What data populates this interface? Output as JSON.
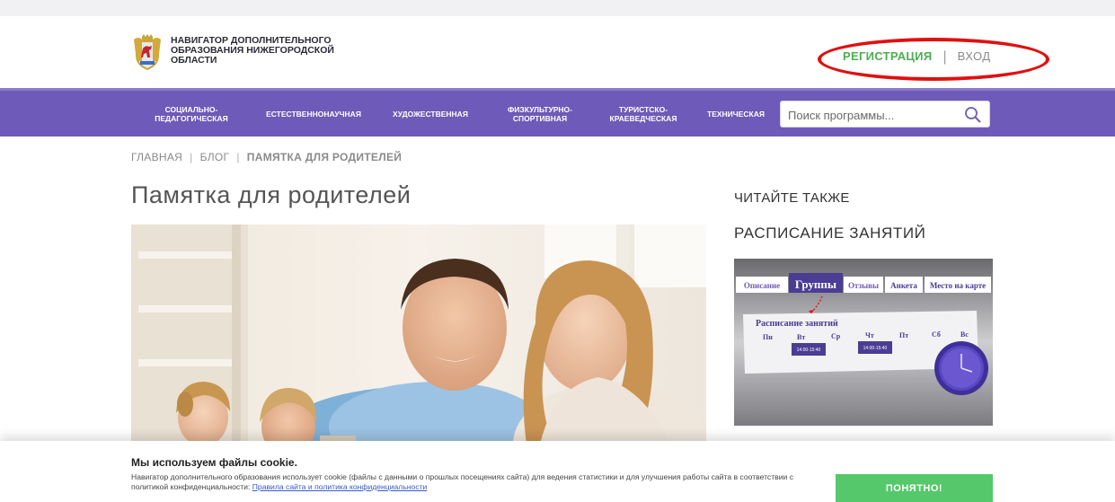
{
  "header": {
    "logo_line1": "НАВИГАТОР ДОПОЛНИТЕЛЬНОГО",
    "logo_line2": "ОБРАЗОВАНИЯ НИЖЕГОРОДСКОЙ",
    "logo_line3": "ОБЛАСТИ",
    "register_label": "РЕГИСТРАЦИЯ",
    "separator": "|",
    "login_label": "ВХОД"
  },
  "nav": {
    "items": [
      {
        "line1": "СОЦИАЛЬНО-",
        "line2": "ПЕДАГОГИЧЕСКАЯ"
      },
      {
        "line1": "ЕСТЕСТВЕННОНАУЧНАЯ",
        "line2": ""
      },
      {
        "line1": "ХУДОЖЕСТВЕННАЯ",
        "line2": ""
      },
      {
        "line1": "ФИЗКУЛЬТУРНО-",
        "line2": "СПОРТИВНАЯ"
      },
      {
        "line1": "ТУРИСТСКО-",
        "line2": "КРАЕВЕДЧЕСКАЯ"
      },
      {
        "line1": "ТЕХНИЧЕСКАЯ",
        "line2": ""
      }
    ],
    "search_placeholder": "Поиск программы...",
    "search_icon": "search-icon"
  },
  "breadcrumb": {
    "home": "ГЛАВНАЯ",
    "blog": "БЛОГ",
    "current": "ПАМЯТКА ДЛЯ РОДИТЕЛЕЙ",
    "sep": "|"
  },
  "main": {
    "title": "Памятка для родителей"
  },
  "sidebar": {
    "heading": "ЧИТАЙТЕ ТАКЖЕ",
    "article_title": "РАСПИСАНИЕ ЗАНЯТИЙ",
    "thumb": {
      "tabs": [
        "Описание",
        "Группы",
        "Отзывы",
        "Анкета",
        "Место на карте"
      ],
      "schedule_title": "Расписание занятий",
      "days": [
        "Пн",
        "Вт",
        "Ср",
        "Чт",
        "Пт",
        "Сб",
        "Вс"
      ],
      "slot1": "14:00-15:40",
      "slot2": "14:00-15:40"
    }
  },
  "cookie": {
    "title": "Мы используем файлы cookie.",
    "text": "Навигатор дополнительного образования использует cookie (файлы с данными о прошлых посещениях сайта) для ведения статистики и для улучшения работы сайта в соответствии с политикой конфиденциальности: ",
    "link": "Правила сайта и политика конфиденциальности",
    "button": "ПОНЯТНО!"
  },
  "colors": {
    "nav_bg": "#6e5ab8",
    "register": "#4caf50",
    "highlight": "#e01010",
    "accept_button": "#54c86a"
  }
}
